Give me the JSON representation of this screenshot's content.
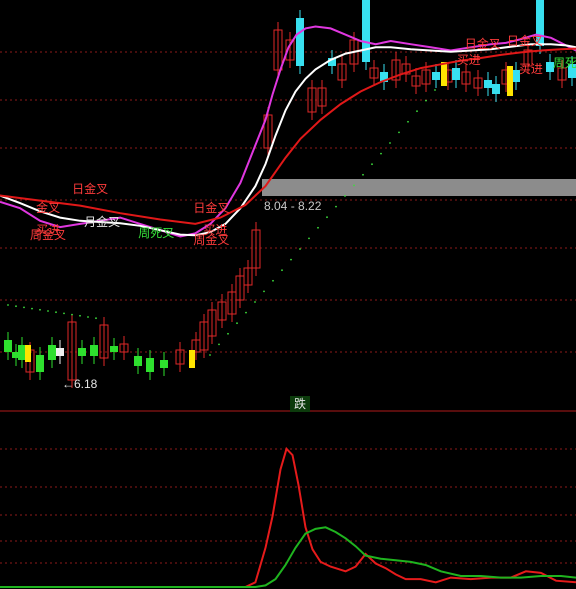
{
  "chart_data": [
    {
      "type": "candlestick",
      "price_band_label": "8.04 - 8.22",
      "low_annotation": "6.18",
      "x_range": [
        0,
        575
      ],
      "y_range": [
        3.5,
        10.0
      ],
      "annotations": [
        {
          "text": "日金叉",
          "x": 72,
          "y": 7.0,
          "color": "red"
        },
        {
          "text": "金叉",
          "x": 36,
          "y": 6.7,
          "color": "red"
        },
        {
          "text": "买进",
          "x": 36,
          "y": 6.35,
          "color": "red"
        },
        {
          "text": "周金叉",
          "x": 30,
          "y": 6.28,
          "color": "red"
        },
        {
          "text": "月金叉",
          "x": 84,
          "y": 6.48,
          "color": "white"
        },
        {
          "text": "周死叉",
          "x": 138,
          "y": 6.3,
          "color": "green"
        },
        {
          "text": "日金叉",
          "x": 193,
          "y": 6.7,
          "color": "red"
        },
        {
          "text": "买进",
          "x": 203,
          "y": 6.35,
          "color": "red"
        },
        {
          "text": "周金叉",
          "x": 193,
          "y": 6.2,
          "color": "red"
        },
        {
          "text": "日金叉",
          "x": 464,
          "y": 9.3,
          "color": "red"
        },
        {
          "text": "买进",
          "x": 456,
          "y": 9.05,
          "color": "red"
        },
        {
          "text": "日金叉",
          "x": 506,
          "y": 9.35,
          "color": "red"
        },
        {
          "text": "买进",
          "x": 518,
          "y": 8.9,
          "color": "red"
        },
        {
          "text": "周死叉",
          "x": 552,
          "y": 9.0,
          "color": "green"
        }
      ],
      "series": [
        {
          "color": "#e037e0",
          "x": [
            0,
            20,
            40,
            60,
            80,
            100,
            120,
            140,
            160,
            180,
            195,
            210,
            225,
            240,
            255,
            265,
            272,
            280,
            288,
            296,
            305,
            315,
            330,
            345,
            360,
            375,
            390,
            410,
            430,
            450,
            470,
            490,
            505,
            520,
            535,
            550,
            565,
            575
          ],
          "values": [
            6.8,
            6.7,
            6.5,
            6.4,
            6.45,
            6.5,
            6.55,
            6.45,
            6.35,
            6.25,
            6.3,
            6.45,
            6.7,
            7.1,
            7.7,
            8.1,
            8.5,
            8.9,
            9.25,
            9.45,
            9.55,
            9.58,
            9.55,
            9.45,
            9.35,
            9.3,
            9.35,
            9.3,
            9.25,
            9.2,
            9.25,
            9.3,
            9.32,
            9.38,
            9.45,
            9.4,
            9.28,
            9.2
          ]
        },
        {
          "color": "#ffffff",
          "x": [
            0,
            20,
            40,
            60,
            80,
            100,
            120,
            140,
            160,
            180,
            195,
            210,
            225,
            240,
            255,
            265,
            275,
            285,
            295,
            305,
            315,
            330,
            345,
            360,
            375,
            390,
            410,
            430,
            450,
            470,
            490,
            510,
            530,
            550,
            565,
            575
          ],
          "values": [
            6.9,
            6.78,
            6.65,
            6.55,
            6.5,
            6.48,
            6.46,
            6.42,
            6.35,
            6.28,
            6.27,
            6.32,
            6.45,
            6.7,
            7.05,
            7.4,
            7.85,
            8.25,
            8.55,
            8.75,
            8.9,
            9.05,
            9.15,
            9.2,
            9.25,
            9.25,
            9.22,
            9.2,
            9.18,
            9.2,
            9.22,
            9.26,
            9.3,
            9.3,
            9.28,
            9.25
          ]
        },
        {
          "color": "#e01818",
          "x": [
            0,
            40,
            80,
            120,
            160,
            195,
            220,
            245,
            265,
            285,
            300,
            320,
            340,
            360,
            380,
            400,
            420,
            440,
            460,
            480,
            500,
            520,
            540,
            560,
            575
          ],
          "values": [
            6.9,
            6.82,
            6.74,
            6.62,
            6.52,
            6.45,
            6.55,
            6.75,
            7.05,
            7.5,
            7.8,
            8.1,
            8.35,
            8.55,
            8.7,
            8.82,
            8.92,
            8.98,
            9.04,
            9.08,
            9.13,
            9.17,
            9.2,
            9.22,
            9.23
          ]
        }
      ]
    },
    {
      "type": "line",
      "title": "跌",
      "x_range": [
        0,
        575
      ],
      "y_range": [
        0,
        100
      ],
      "series": [
        {
          "color": "#e61b1b",
          "x": [
            0,
            245,
            255,
            265,
            272,
            280,
            286,
            292,
            298,
            305,
            312,
            320,
            330,
            345,
            355,
            365,
            375,
            385,
            395,
            405,
            420,
            435,
            450,
            470,
            490,
            510,
            525,
            540,
            555,
            575
          ],
          "values": [
            0,
            0,
            3,
            25,
            45,
            75,
            88,
            84,
            65,
            38,
            24,
            16,
            13,
            10,
            13,
            21,
            15,
            12,
            8,
            5,
            5,
            3,
            6,
            5,
            6,
            6,
            10,
            9,
            4,
            3
          ]
        },
        {
          "color": "#1fb41f",
          "x": [
            0,
            255,
            265,
            275,
            285,
            295,
            305,
            315,
            325,
            335,
            345,
            355,
            365,
            380,
            395,
            410,
            425,
            440,
            460,
            480,
            500,
            520,
            540,
            560,
            575
          ],
          "values": [
            0,
            0,
            1,
            5,
            14,
            25,
            34,
            37,
            38,
            35,
            31,
            26,
            20,
            18,
            17,
            16,
            14,
            10,
            7,
            7,
            6,
            6,
            7,
            7,
            6
          ]
        }
      ]
    }
  ]
}
